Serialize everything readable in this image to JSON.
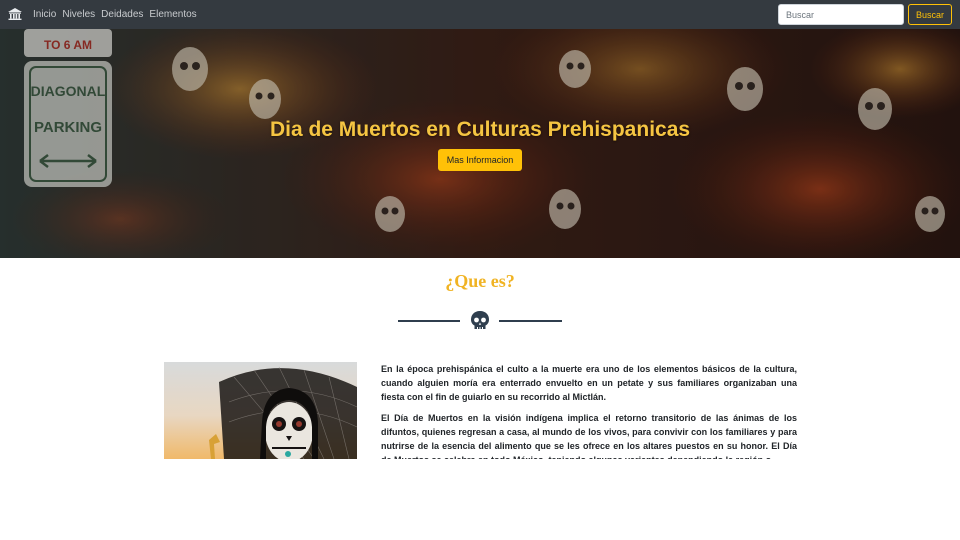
{
  "navbar": {
    "brand_icon": "temple-icon",
    "links": [
      "Inicio",
      "Niveles",
      "Deidades",
      "Elementos"
    ],
    "search_placeholder": "Buscar",
    "search_button": "Buscar"
  },
  "hero": {
    "title": "Dia de Muertos en Culturas Prehispanicas",
    "button": "Mas Informacion",
    "sign_line1": "DIAGONAL",
    "sign_line2": "PARKING",
    "sign_top": "TO 6 AM"
  },
  "section": {
    "title": "¿Que es?",
    "divider_icon": "skull-icon",
    "paragraph1": "En la época prehispánica el culto a la muerte era uno de los elementos básicos de la cultura, cuando alguien moría era enterrado envuelto en un petate y sus familiares organizaban una fiesta con el fin de guiarlo en su recorrido al Mictlán.",
    "paragraph2": "El Día de Muertos en la visión indígena implica el retorno transitorio de las ánimas de los difuntos, quienes regresan a casa, al mundo de los vivos, para convivir con los familiares y para nutrirse de la esencia del alimento que se les ofrece en los altares puestos en su honor. El Día de Muertos se celebra en todo México, teniendo algunas variantes dependiendo la región o"
  },
  "colors": {
    "navbar_bg": "#343a40",
    "accent": "#ffc107",
    "section_title": "#f0b323",
    "divider": "#2f3e4e"
  }
}
